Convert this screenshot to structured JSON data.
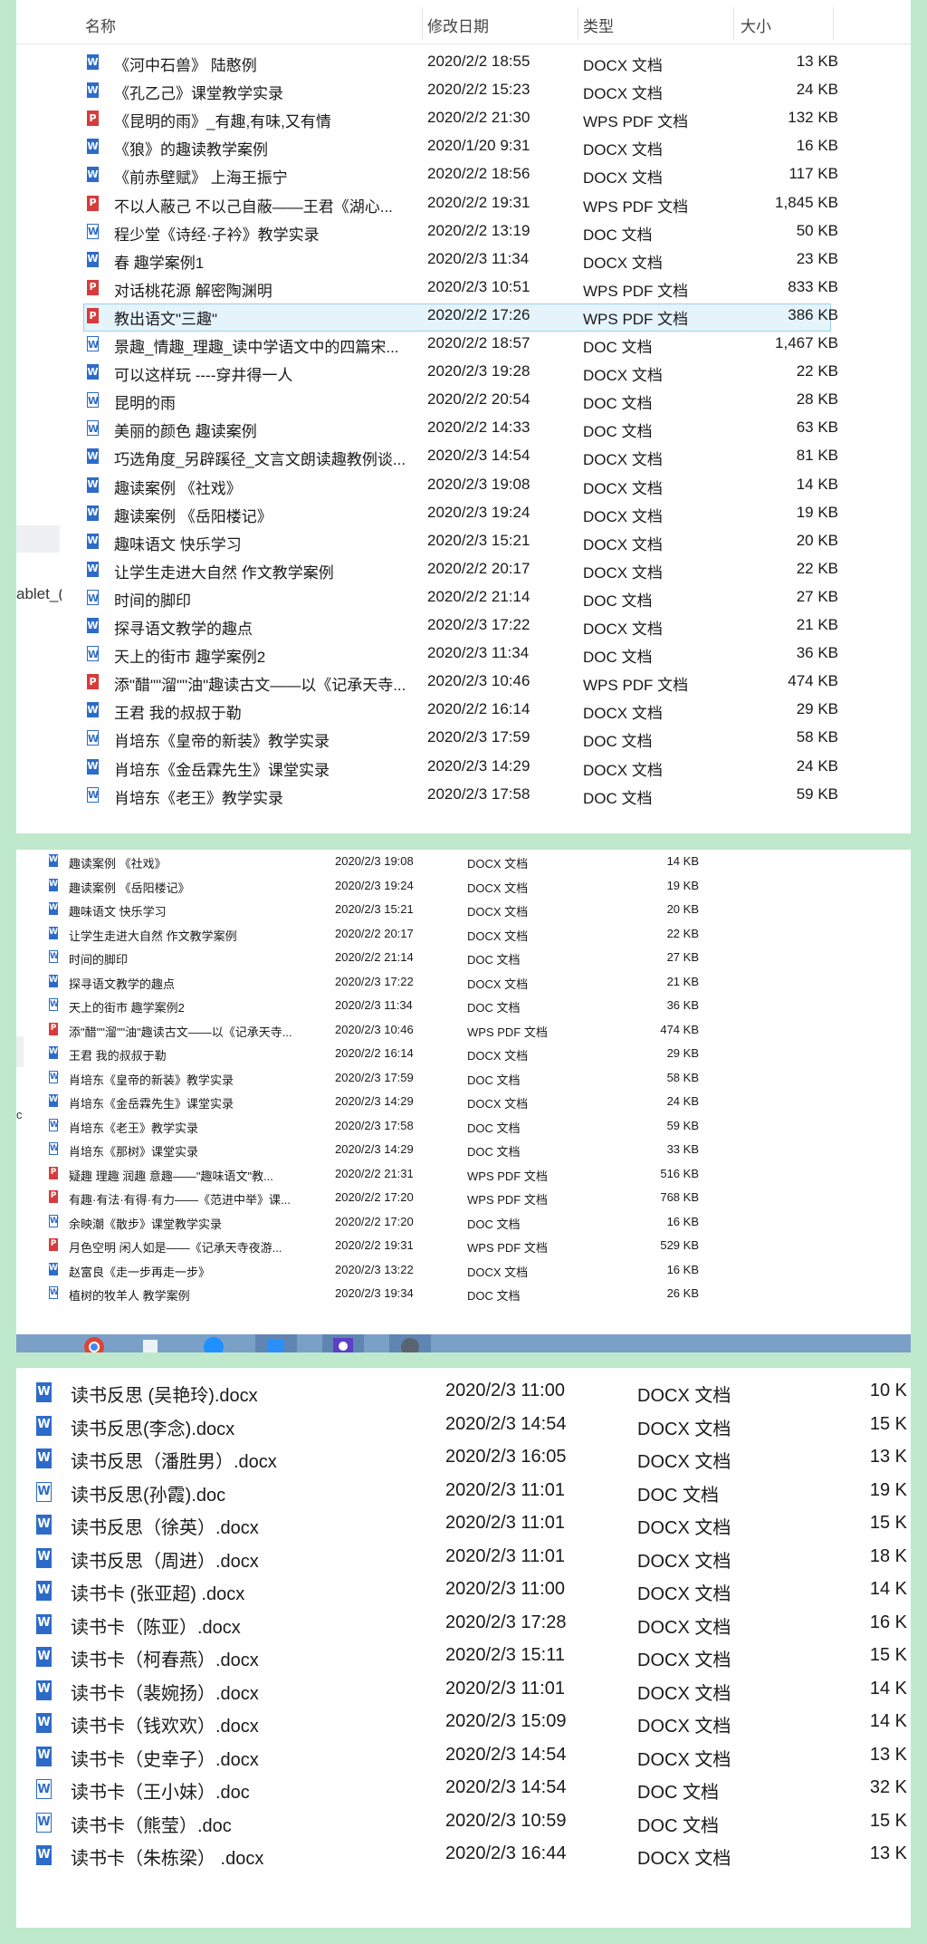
{
  "panel1": {
    "header": {
      "name": "名称",
      "date": "修改日期",
      "type": "类型",
      "size": "大小"
    },
    "side_text": "ablet_(",
    "rows": [
      {
        "name": "《河中石兽》 陆憨例",
        "date": "2020/2/2 18:55",
        "type": "DOCX 文档",
        "size": "13 KB",
        "icon": "docx"
      },
      {
        "name": "《孔乙己》课堂教学实录",
        "date": "2020/2/2 15:23",
        "type": "DOCX 文档",
        "size": "24 KB",
        "icon": "docx"
      },
      {
        "name": "《昆明的雨》_有趣,有味,又有情",
        "date": "2020/2/2 21:30",
        "type": "WPS PDF 文档",
        "size": "132 KB",
        "icon": "pdf"
      },
      {
        "name": "《狼》的趣读教学案例",
        "date": "2020/1/20 9:31",
        "type": "DOCX 文档",
        "size": "16 KB",
        "icon": "docx"
      },
      {
        "name": "《前赤壁赋》 上海王振宁",
        "date": "2020/2/2 18:56",
        "type": "DOCX 文档",
        "size": "117 KB",
        "icon": "docx"
      },
      {
        "name": "不以人蔽己 不以己自蔽——王君《湖心...",
        "date": "2020/2/2 19:31",
        "type": "WPS PDF 文档",
        "size": "1,845 KB",
        "icon": "pdf"
      },
      {
        "name": "程少堂《诗经·子衿》教学实录",
        "date": "2020/2/2 13:19",
        "type": "DOC 文档",
        "size": "50 KB",
        "icon": "doc"
      },
      {
        "name": "春 趣学案例1",
        "date": "2020/2/3 11:34",
        "type": "DOCX 文档",
        "size": "23 KB",
        "icon": "docx"
      },
      {
        "name": "对话桃花源 解密陶渊明",
        "date": "2020/2/3 10:51",
        "type": "WPS PDF 文档",
        "size": "833 KB",
        "icon": "pdf"
      },
      {
        "name": "教出语文\"三趣\"",
        "date": "2020/2/2 17:26",
        "type": "WPS PDF 文档",
        "size": "386 KB",
        "icon": "pdf",
        "selected": true
      },
      {
        "name": "景趣_情趣_理趣_读中学语文中的四篇宋...",
        "date": "2020/2/2 18:57",
        "type": "DOC 文档",
        "size": "1,467 KB",
        "icon": "doc"
      },
      {
        "name": "可以这样玩 ----穿井得一人",
        "date": "2020/2/3 19:28",
        "type": "DOCX 文档",
        "size": "22 KB",
        "icon": "docx"
      },
      {
        "name": "昆明的雨",
        "date": "2020/2/2 20:54",
        "type": "DOC 文档",
        "size": "28 KB",
        "icon": "doc"
      },
      {
        "name": "美丽的颜色 趣读案例",
        "date": "2020/2/2 14:33",
        "type": "DOC 文档",
        "size": "63 KB",
        "icon": "doc"
      },
      {
        "name": "巧选角度_另辟蹊径_文言文朗读趣教例谈...",
        "date": "2020/2/3 14:54",
        "type": "DOCX 文档",
        "size": "81 KB",
        "icon": "docx"
      },
      {
        "name": "趣读案例 《社戏》",
        "date": "2020/2/3 19:08",
        "type": "DOCX 文档",
        "size": "14 KB",
        "icon": "docx"
      },
      {
        "name": "趣读案例 《岳阳楼记》",
        "date": "2020/2/3 19:24",
        "type": "DOCX 文档",
        "size": "19 KB",
        "icon": "docx"
      },
      {
        "name": "趣味语文 快乐学习",
        "date": "2020/2/3 15:21",
        "type": "DOCX 文档",
        "size": "20 KB",
        "icon": "docx"
      },
      {
        "name": "让学生走进大自然 作文教学案例",
        "date": "2020/2/2 20:17",
        "type": "DOCX 文档",
        "size": "22 KB",
        "icon": "docx"
      },
      {
        "name": "时间的脚印",
        "date": "2020/2/2 21:14",
        "type": "DOC 文档",
        "size": "27 KB",
        "icon": "doc"
      },
      {
        "name": "探寻语文教学的趣点",
        "date": "2020/2/3 17:22",
        "type": "DOCX 文档",
        "size": "21 KB",
        "icon": "docx"
      },
      {
        "name": "天上的街市 趣学案例2",
        "date": "2020/2/3 11:34",
        "type": "DOC 文档",
        "size": "36 KB",
        "icon": "doc"
      },
      {
        "name": "添\"醋\"\"溜\"\"油\"趣读古文——以《记承天寺...",
        "date": "2020/2/3 10:46",
        "type": "WPS PDF 文档",
        "size": "474 KB",
        "icon": "pdf"
      },
      {
        "name": "王君 我的叔叔于勒",
        "date": "2020/2/2 16:14",
        "type": "DOCX 文档",
        "size": "29 KB",
        "icon": "docx"
      },
      {
        "name": "肖培东《皇帝的新装》教学实录",
        "date": "2020/2/3 17:59",
        "type": "DOC 文档",
        "size": "58 KB",
        "icon": "doc"
      },
      {
        "name": "肖培东《金岳霖先生》课堂实录",
        "date": "2020/2/3 14:29",
        "type": "DOCX 文档",
        "size": "24 KB",
        "icon": "docx"
      },
      {
        "name": "肖培东《老王》教学实录",
        "date": "2020/2/3 17:58",
        "type": "DOC 文档",
        "size": "59 KB",
        "icon": "doc"
      }
    ]
  },
  "panel2": {
    "side_text": "c",
    "rows": [
      {
        "name": "趣读案例 《社戏》",
        "date": "2020/2/3 19:08",
        "type": "DOCX 文档",
        "size": "14 KB",
        "icon": "docx"
      },
      {
        "name": "趣读案例 《岳阳楼记》",
        "date": "2020/2/3 19:24",
        "type": "DOCX 文档",
        "size": "19 KB",
        "icon": "docx"
      },
      {
        "name": "趣味语文 快乐学习",
        "date": "2020/2/3 15:21",
        "type": "DOCX 文档",
        "size": "20 KB",
        "icon": "docx"
      },
      {
        "name": "让学生走进大自然 作文教学案例",
        "date": "2020/2/2 20:17",
        "type": "DOCX 文档",
        "size": "22 KB",
        "icon": "docx"
      },
      {
        "name": "时间的脚印",
        "date": "2020/2/2 21:14",
        "type": "DOC 文档",
        "size": "27 KB",
        "icon": "doc"
      },
      {
        "name": "探寻语文教学的趣点",
        "date": "2020/2/3 17:22",
        "type": "DOCX 文档",
        "size": "21 KB",
        "icon": "docx"
      },
      {
        "name": "天上的街市 趣学案例2",
        "date": "2020/2/3 11:34",
        "type": "DOC 文档",
        "size": "36 KB",
        "icon": "doc"
      },
      {
        "name": "添\"醋\"\"溜\"\"油\"趣读古文——以《记承天寺...",
        "date": "2020/2/3 10:46",
        "type": "WPS PDF 文档",
        "size": "474 KB",
        "icon": "pdf"
      },
      {
        "name": "王君 我的叔叔于勒",
        "date": "2020/2/2 16:14",
        "type": "DOCX 文档",
        "size": "29 KB",
        "icon": "docx"
      },
      {
        "name": "肖培东《皇帝的新装》教学实录",
        "date": "2020/2/3 17:59",
        "type": "DOC 文档",
        "size": "58 KB",
        "icon": "doc"
      },
      {
        "name": "肖培东《金岳霖先生》课堂实录",
        "date": "2020/2/3 14:29",
        "type": "DOCX 文档",
        "size": "24 KB",
        "icon": "docx"
      },
      {
        "name": "肖培东《老王》教学实录",
        "date": "2020/2/3 17:58",
        "type": "DOC 文档",
        "size": "59 KB",
        "icon": "doc"
      },
      {
        "name": "肖培东《那树》课堂实录",
        "date": "2020/2/3 14:29",
        "type": "DOC 文档",
        "size": "33 KB",
        "icon": "doc"
      },
      {
        "name": "疑趣 理趣 润趣 意趣——\"趣味语文\"教...",
        "date": "2020/2/2 21:31",
        "type": "WPS PDF 文档",
        "size": "516 KB",
        "icon": "pdf"
      },
      {
        "name": "有趣·有法·有得·有力——《范进中举》课...",
        "date": "2020/2/2 17:20",
        "type": "WPS PDF 文档",
        "size": "768 KB",
        "icon": "pdf"
      },
      {
        "name": "余映潮《散步》课堂教学实录",
        "date": "2020/2/2 17:20",
        "type": "DOC 文档",
        "size": "16 KB",
        "icon": "doc"
      },
      {
        "name": "月色空明 闲人如是——《记承天寺夜游...",
        "date": "2020/2/2 19:31",
        "type": "WPS PDF 文档",
        "size": "529 KB",
        "icon": "pdf"
      },
      {
        "name": "赵富良《走一步再走一步》",
        "date": "2020/2/3 13:22",
        "type": "DOCX 文档",
        "size": "16 KB",
        "icon": "docx"
      },
      {
        "name": "植树的牧羊人 教学案例",
        "date": "2020/2/3 19:34",
        "type": "DOC 文档",
        "size": "26 KB",
        "icon": "doc"
      }
    ]
  },
  "panel3": {
    "rows": [
      {
        "name": "读书反思 (吴艳玲).docx",
        "date": "2020/2/3 11:00",
        "type": "DOCX 文档",
        "size": "10 K",
        "icon": "docx"
      },
      {
        "name": "读书反思(李念).docx",
        "date": "2020/2/3 14:54",
        "type": "DOCX 文档",
        "size": "15 K",
        "icon": "docx"
      },
      {
        "name": "读书反思（潘胜男）.docx",
        "date": "2020/2/3 16:05",
        "type": "DOCX 文档",
        "size": "13 K",
        "icon": "docx"
      },
      {
        "name": "读书反思(孙霞).doc",
        "date": "2020/2/3 11:01",
        "type": "DOC 文档",
        "size": "19 K",
        "icon": "doc"
      },
      {
        "name": "读书反思（徐英）.docx",
        "date": "2020/2/3 11:01",
        "type": "DOCX 文档",
        "size": "15 K",
        "icon": "docx"
      },
      {
        "name": "读书反思（周进）.docx",
        "date": "2020/2/3 11:01",
        "type": "DOCX 文档",
        "size": "18 K",
        "icon": "docx"
      },
      {
        "name": "读书卡 (张亚超) .docx",
        "date": "2020/2/3 11:00",
        "type": "DOCX 文档",
        "size": "14 K",
        "icon": "docx"
      },
      {
        "name": "读书卡（陈亚）.docx",
        "date": "2020/2/3 17:28",
        "type": "DOCX 文档",
        "size": "16 K",
        "icon": "docx"
      },
      {
        "name": "读书卡（柯春燕）.docx",
        "date": "2020/2/3 15:11",
        "type": "DOCX 文档",
        "size": "15 K",
        "icon": "docx"
      },
      {
        "name": "读书卡（裴婉扬）.docx",
        "date": "2020/2/3 11:01",
        "type": "DOCX 文档",
        "size": "14 K",
        "icon": "docx"
      },
      {
        "name": "读书卡（钱欢欢）.docx",
        "date": "2020/2/3 15:09",
        "type": "DOCX 文档",
        "size": "14 K",
        "icon": "docx"
      },
      {
        "name": "读书卡（史幸子）.docx",
        "date": "2020/2/3 14:54",
        "type": "DOCX 文档",
        "size": "13 K",
        "icon": "docx"
      },
      {
        "name": "读书卡（王小妹）.doc",
        "date": "2020/2/3 14:54",
        "type": "DOC 文档",
        "size": "32 K",
        "icon": "doc"
      },
      {
        "name": "读书卡（熊莹）.doc",
        "date": "2020/2/3 10:59",
        "type": "DOC 文档",
        "size": "15 K",
        "icon": "doc"
      },
      {
        "name": "读书卡（朱栋梁） .docx",
        "date": "2020/2/3 16:44",
        "type": "DOCX 文档",
        "size": "13 K",
        "icon": "docx"
      }
    ]
  },
  "icons": {
    "docx": "word-docx-icon",
    "doc": "word-doc-icon",
    "pdf": "pdf-icon"
  },
  "colors": {
    "background": "#bfe9cc",
    "selection": "#e5f3fb",
    "selection_border": "#99d1ef",
    "word_blue": "#2d6bc9",
    "pdf_red": "#d83b3b"
  }
}
